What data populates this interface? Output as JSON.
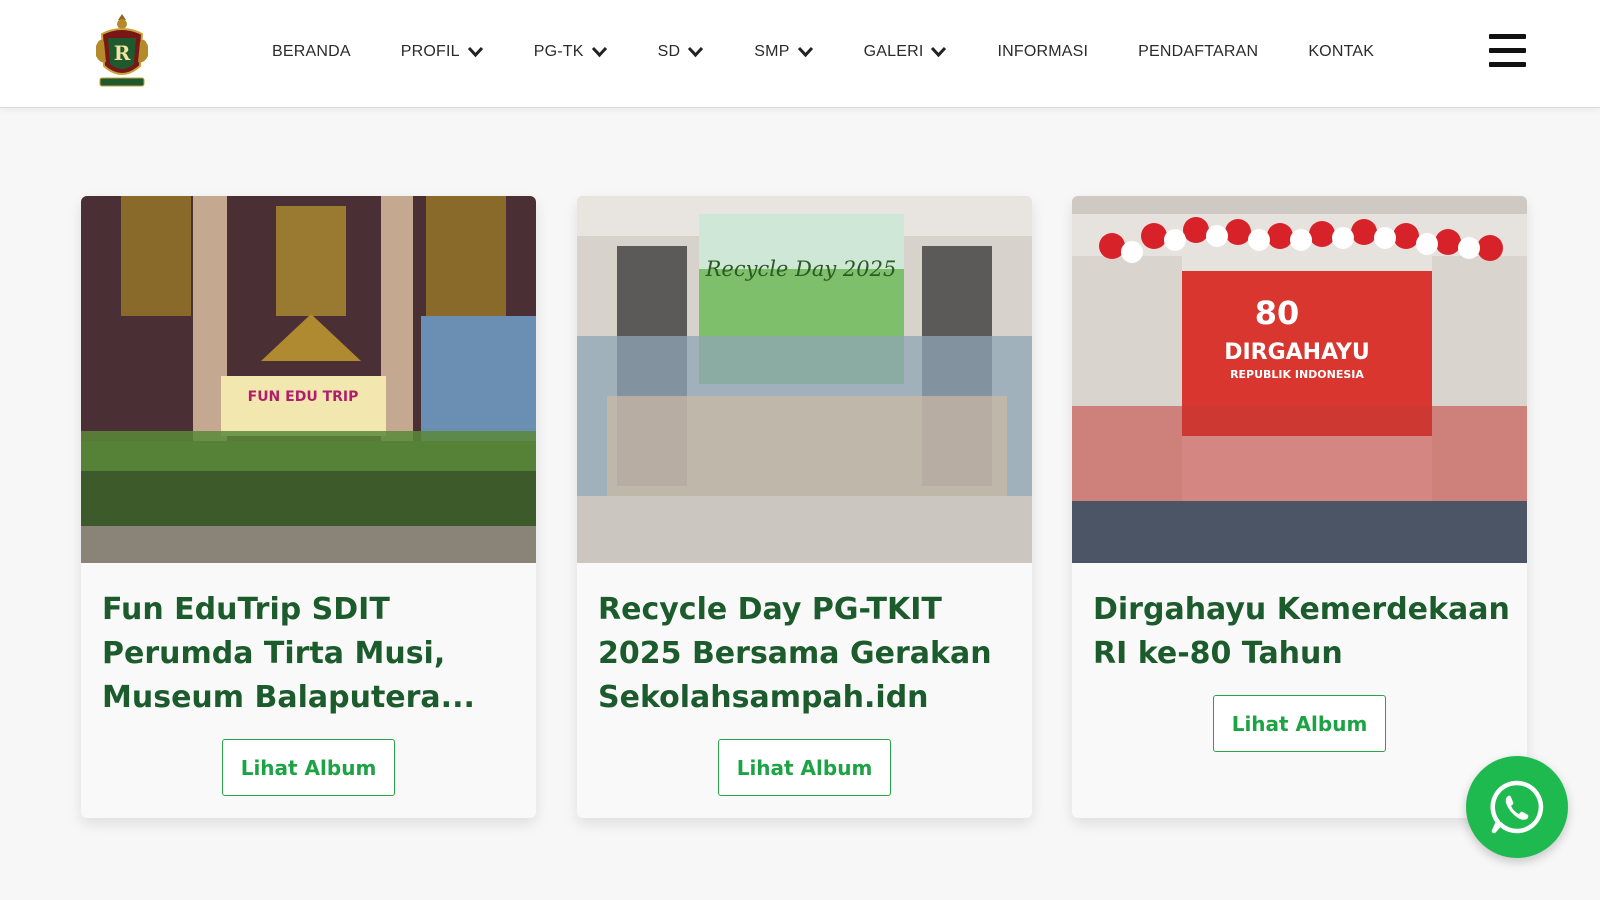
{
  "header": {
    "logo_icon": "school-crest-icon",
    "nav": [
      {
        "label": "BERANDA",
        "dropdown": false
      },
      {
        "label": "PROFIL",
        "dropdown": true
      },
      {
        "label": "PG-TK",
        "dropdown": true
      },
      {
        "label": "SD",
        "dropdown": true
      },
      {
        "label": "SMP",
        "dropdown": true
      },
      {
        "label": "GALERI",
        "dropdown": true
      },
      {
        "label": "INFORMASI",
        "dropdown": false
      },
      {
        "label": "PENDAFTARAN",
        "dropdown": false
      },
      {
        "label": "KONTAK",
        "dropdown": false
      }
    ],
    "menu_icon": "hamburger-menu-icon"
  },
  "albums": [
    {
      "title": "Fun EduTrip SDIT Perumda Tirta Musi, Museum Balaputera...",
      "button_label": "Lihat Album",
      "banner_text": "FUN EDU TRIP"
    },
    {
      "title": "Recycle Day PG-TKIT 2025 Bersama Gerakan Sekolahsampah.idn",
      "button_label": "Lihat Album",
      "banner_text": "Recycle Day 2025"
    },
    {
      "title": "Dirgahayu Kemerdekaan RI ke-80 Tahun",
      "button_label": "Lihat Album",
      "banner_text_1": "80",
      "banner_text_2": "DIRGAHAYU",
      "banner_text_3": "REPUBLIK INDONESIA"
    }
  ],
  "whatsapp": {
    "icon": "whatsapp-icon"
  },
  "colors": {
    "title_green": "#1c5b2c",
    "button_green": "#1da345",
    "whatsapp_green": "#1fba4f"
  }
}
